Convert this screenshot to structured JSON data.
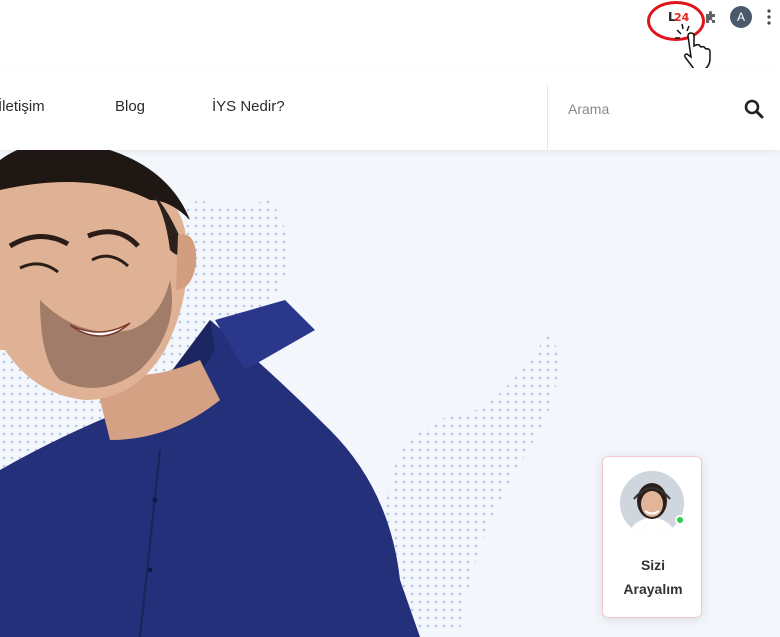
{
  "browser": {
    "extension": {
      "letter": "L",
      "number": "24"
    },
    "profile_initial": "A"
  },
  "nav": {
    "items": [
      {
        "label": "İletişim"
      },
      {
        "label": "Blog"
      },
      {
        "label": "İYS Nedir?"
      }
    ],
    "search": {
      "placeholder": "Arama"
    }
  },
  "call_card": {
    "line1": "Sizi",
    "line2": "Arayalım"
  },
  "colors": {
    "accent_red": "#e0141b",
    "hero_bg": "#f3f6fb",
    "shirt_navy": "#24307a",
    "online_green": "#2ecc4a"
  },
  "icons": [
    "extension-l24-icon",
    "puzzle-icon",
    "kebab-menu-icon",
    "hand-pointer-icon",
    "search-icon"
  ]
}
